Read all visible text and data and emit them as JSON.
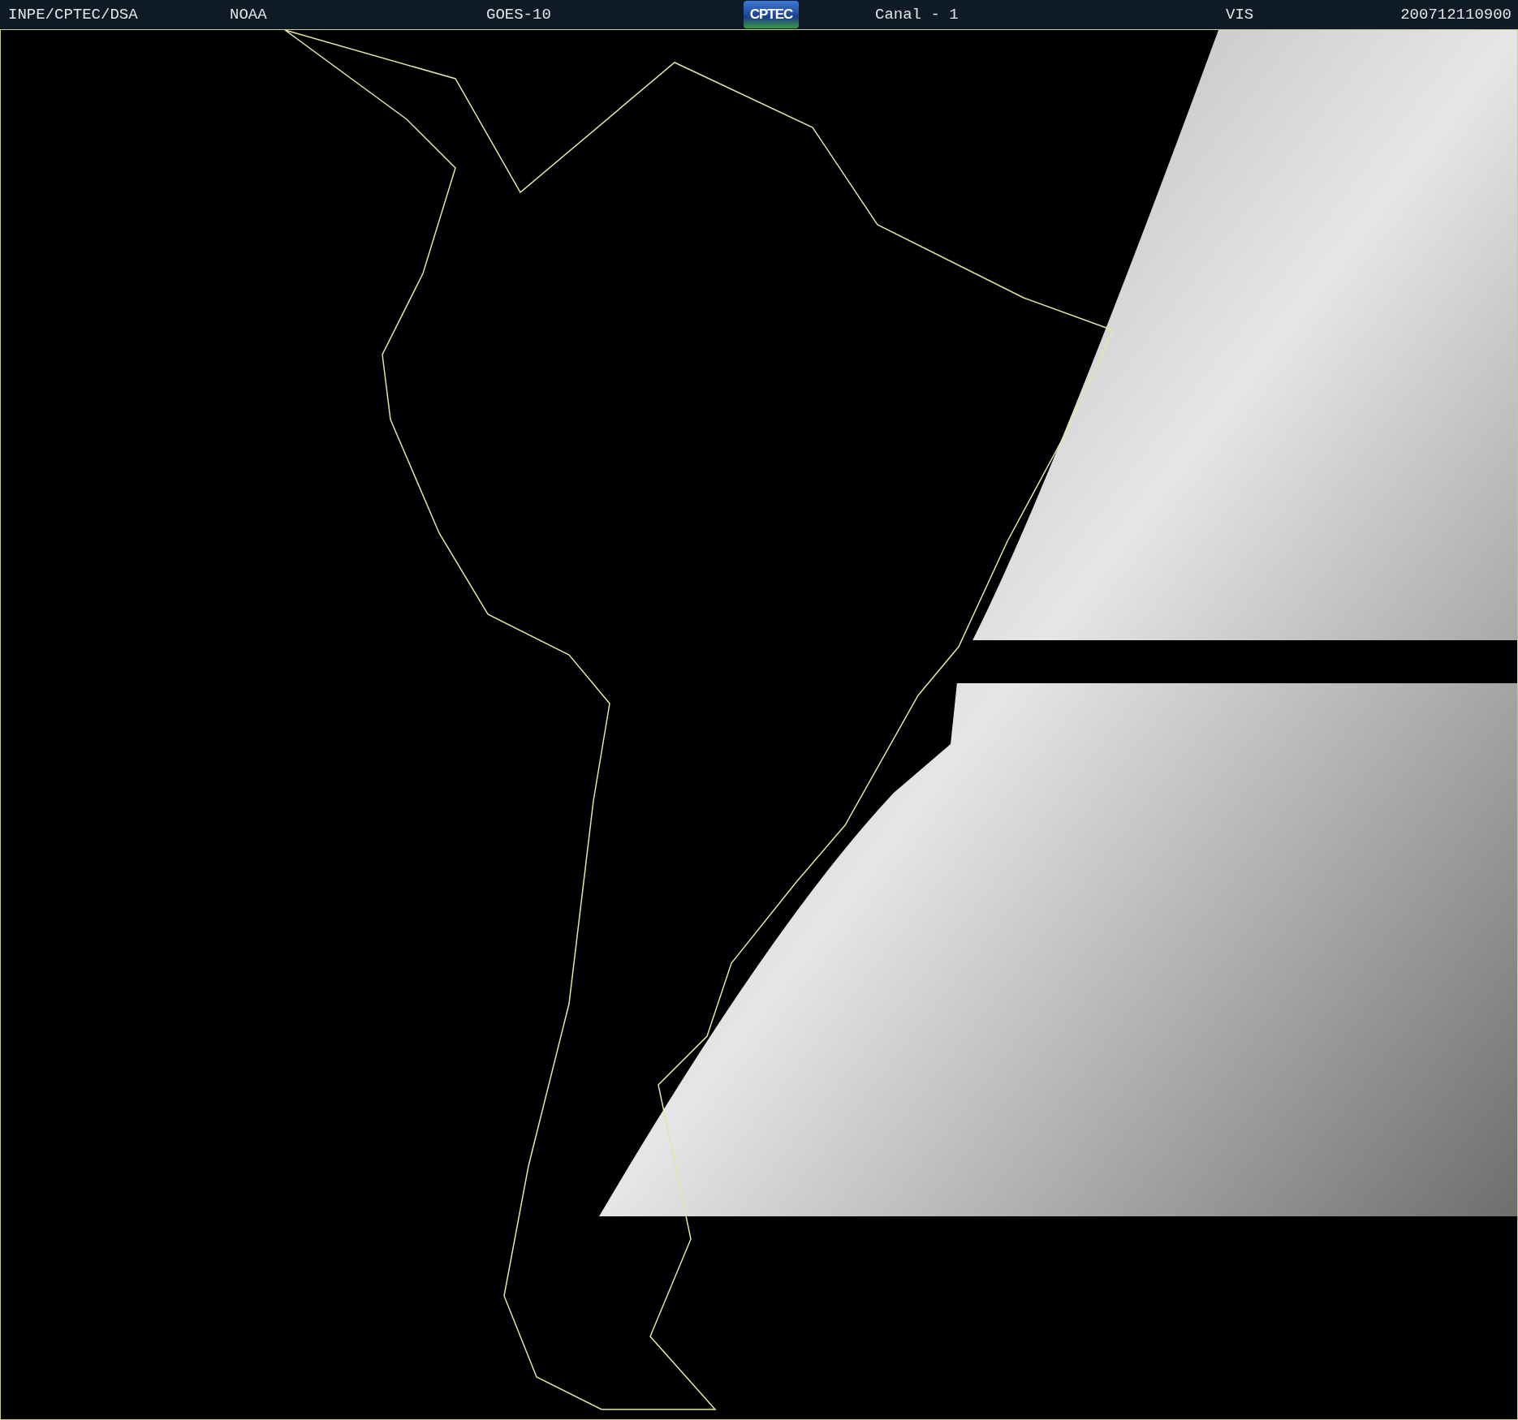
{
  "header": {
    "items": [
      {
        "text": "INPE/CPTEC/DSA"
      },
      {
        "text": "NOAA"
      },
      {
        "text": "GOES-10"
      },
      {
        "kind": "logo",
        "text": "CPTEC"
      },
      {
        "text": "Canal - 1"
      },
      {
        "text": "VIS"
      },
      {
        "text": "200712110900"
      }
    ]
  }
}
